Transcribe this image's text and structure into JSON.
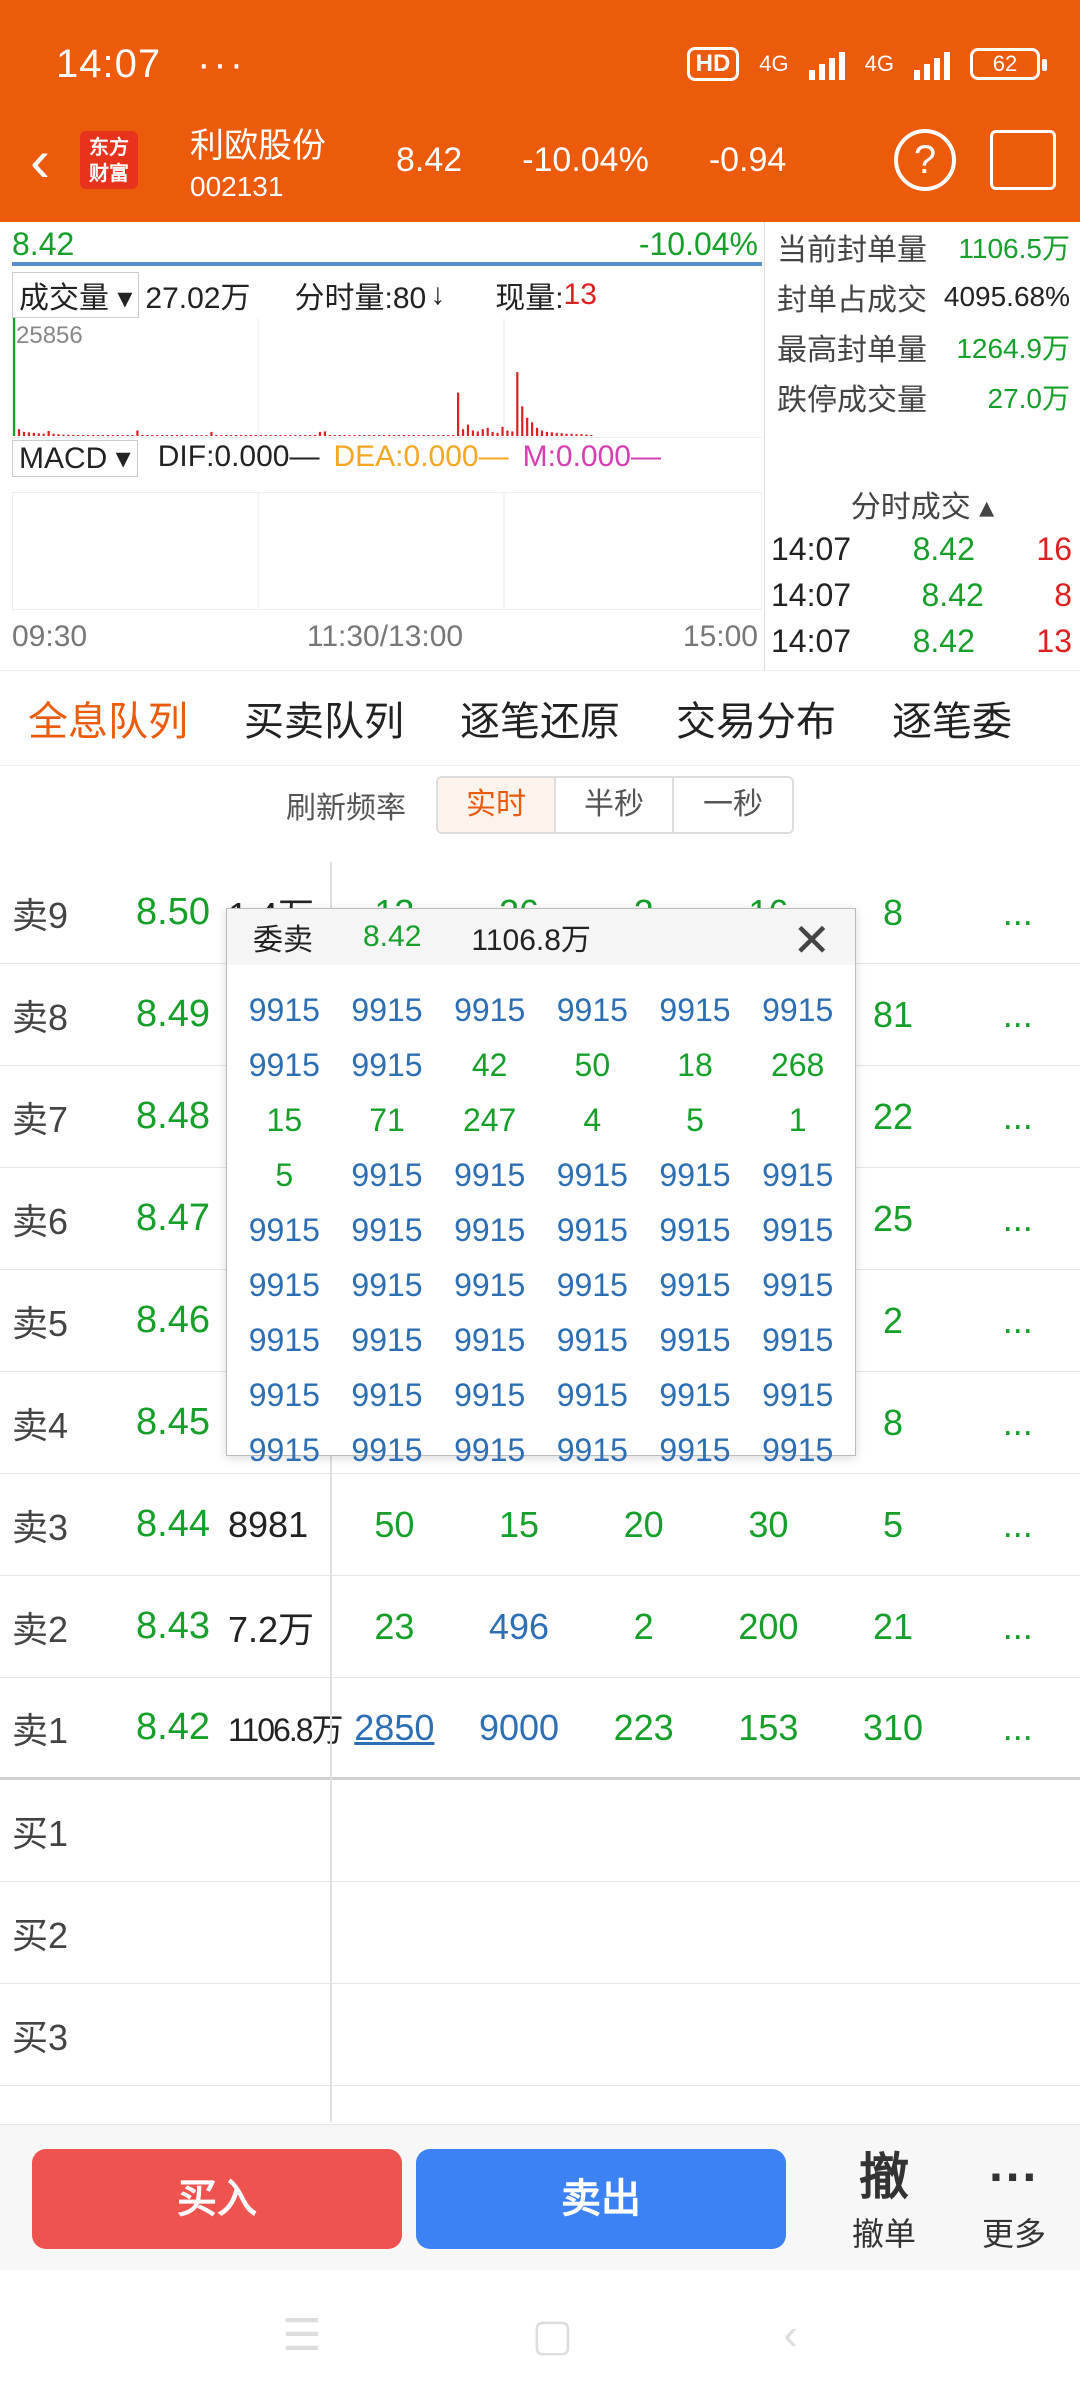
{
  "status": {
    "time": "14:07",
    "dots": "···",
    "hd": "HD",
    "net": "4G",
    "net2": "4G",
    "battery": "62"
  },
  "header": {
    "back_icon": "chevron-left-icon",
    "logo": "东方财富",
    "name": "利欧股份",
    "code": "002131",
    "price": "8.42",
    "pct": "-10.04%",
    "change": "-0.94",
    "help": "?"
  },
  "chart": {
    "price": "8.42",
    "pct": "-10.04%",
    "vol_label": "成交量",
    "vol_value": "27.02万",
    "minute_vol": "分时量:80",
    "minute_arrow": "↓",
    "current_label": "现量:",
    "current_value": "13",
    "max_label": "25856",
    "macd": "MACD",
    "dif": "DIF:0.000—",
    "dea": "DEA:0.000—",
    "m": "M:0.000—",
    "axis": [
      "09:30",
      "11:30/13:00",
      "15:00"
    ]
  },
  "chart_data": {
    "type": "bar",
    "title": "",
    "ylim": [
      0,
      25856
    ],
    "values": [
      25856,
      1500,
      900,
      800,
      700,
      600,
      500,
      1100,
      500,
      400,
      300,
      300,
      250,
      200,
      200,
      220,
      180,
      150,
      140,
      130,
      150,
      160,
      120,
      100,
      130,
      1200,
      150,
      110,
      100,
      90,
      80,
      70,
      90,
      100,
      120,
      80,
      70,
      60,
      60,
      70,
      900,
      60,
      50,
      50,
      50,
      40,
      60,
      40,
      40,
      40,
      30,
      30,
      40,
      50,
      40,
      30,
      30,
      30,
      30,
      50,
      30,
      30,
      900,
      1000,
      40,
      40,
      40,
      40,
      30,
      30,
      50,
      40,
      40,
      30,
      30,
      30,
      40,
      30,
      30,
      30,
      40,
      30,
      30,
      50,
      40,
      40,
      30,
      40,
      30,
      30,
      9500,
      1500,
      2500,
      1200,
      1000,
      1500,
      1800,
      900,
      700,
      2000,
      1200,
      1000,
      14000,
      6500,
      4000,
      3000,
      1800,
      1200,
      900,
      800,
      700,
      600,
      500,
      500,
      400,
      400,
      300,
      200
    ]
  },
  "side": {
    "rows": [
      {
        "k": "当前封单量",
        "v": "1106.5万"
      },
      {
        "k": "封单占成交",
        "v": "4095.68%"
      },
      {
        "k": "最高封单量",
        "v": "1264.9万"
      },
      {
        "k": "跌停成交量",
        "v": "27.0万"
      }
    ],
    "trades_title": "分时成交",
    "trades": [
      {
        "t": "14:07",
        "p": "8.42",
        "q": "16"
      },
      {
        "t": "14:07",
        "p": "8.42",
        "q": "8"
      },
      {
        "t": "14:07",
        "p": "8.42",
        "q": "13"
      }
    ]
  },
  "tabs": [
    "全息队列",
    "买卖队列",
    "逐笔还原",
    "交易分布",
    "逐笔委"
  ],
  "freq": {
    "label": "刷新频率",
    "options": [
      "实时",
      "半秒",
      "一秒"
    ]
  },
  "book": {
    "sell": [
      {
        "label": "卖9",
        "price": "8.50",
        "vol": "1.4万",
        "cells": [
          "13",
          "26",
          "2",
          "16",
          "8"
        ]
      },
      {
        "label": "卖8",
        "price": "8.49",
        "vol": "",
        "cells": [
          "",
          "",
          "",
          "",
          "81"
        ]
      },
      {
        "label": "卖7",
        "price": "8.48",
        "vol": "",
        "cells": [
          "",
          "",
          "",
          "",
          "22"
        ]
      },
      {
        "label": "卖6",
        "price": "8.47",
        "vol": "",
        "cells": [
          "",
          "",
          "",
          "",
          "25"
        ]
      },
      {
        "label": "卖5",
        "price": "8.46",
        "vol": "",
        "cells": [
          "",
          "",
          "",
          "",
          "2"
        ]
      },
      {
        "label": "卖4",
        "price": "8.45",
        "vol": "",
        "cells": [
          "",
          "",
          "",
          "",
          "8"
        ]
      },
      {
        "label": "卖3",
        "price": "8.44",
        "vol": "8981",
        "cells": [
          "50",
          "15",
          "20",
          "30",
          "5"
        ]
      },
      {
        "label": "卖2",
        "price": "8.43",
        "vol": "7.2万",
        "cells": [
          "23",
          "496",
          "2",
          "200",
          "21"
        ]
      },
      {
        "label": "卖1",
        "price": "8.42",
        "vol": "1106.8万",
        "cells": [
          "2850",
          "9000",
          "223",
          "153",
          "310"
        ]
      }
    ],
    "buy": [
      "买1",
      "买2",
      "买3"
    ],
    "more": "..."
  },
  "popup": {
    "title": "委卖",
    "price": "8.42",
    "vol": "1106.8万",
    "close": "✕",
    "cells": [
      "9915",
      "9915",
      "9915",
      "9915",
      "9915",
      "9915",
      "9915",
      "9915",
      "42",
      "50",
      "18",
      "268",
      "15",
      "71",
      "247",
      "4",
      "5",
      "1",
      "5",
      "9915",
      "9915",
      "9915",
      "9915",
      "9915",
      "9915",
      "9915",
      "9915",
      "9915",
      "9915",
      "9915",
      "9915",
      "9915",
      "9915",
      "9915",
      "9915",
      "9915",
      "9915",
      "9915",
      "9915",
      "9915",
      "9915",
      "9915",
      "9915",
      "9915",
      "9915",
      "9915",
      "9915",
      "9915",
      "9915",
      "9915",
      "9915",
      "9915",
      "9915",
      "9915"
    ]
  },
  "bottom": {
    "buy": "买入",
    "sell": "卖出",
    "cancel_icon": "撤",
    "cancel": "撤单",
    "more_icon": "···",
    "more": "更多"
  },
  "colors": {
    "brand": "#ec5a0c",
    "down": "#16a02a",
    "up": "#e02020",
    "blue": "#2d6fb4"
  }
}
